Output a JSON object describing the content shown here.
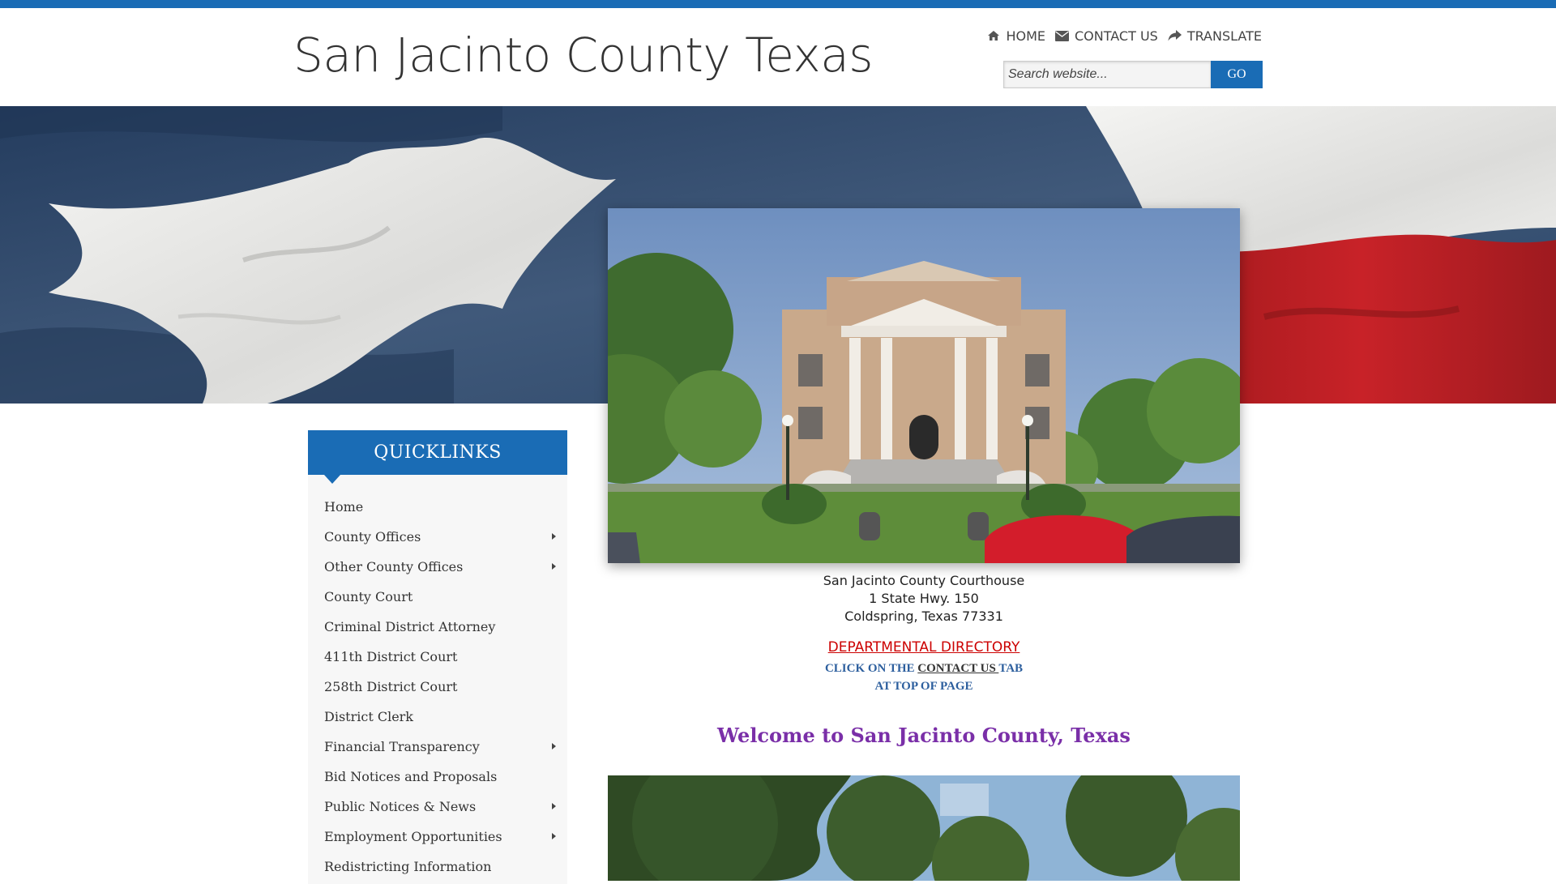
{
  "header": {
    "site_title": "San Jacinto County Texas",
    "nav": [
      {
        "label": "HOME",
        "icon": "home-icon"
      },
      {
        "label": "CONTACT US",
        "icon": "envelope-icon"
      },
      {
        "label": "TRANSLATE",
        "icon": "share-arrow-icon"
      }
    ],
    "search": {
      "placeholder": "Search website...",
      "value": "",
      "button_label": "GO"
    }
  },
  "colors": {
    "accent": "#1a6cb5",
    "link_red": "#cc0000",
    "welcome_purple": "#7a2fa8",
    "note_blue": "#2d5f9e"
  },
  "quicklinks": {
    "title": "QUICKLINKS",
    "items": [
      {
        "label": "Home",
        "has_submenu": false
      },
      {
        "label": "County Offices",
        "has_submenu": true
      },
      {
        "label": "Other County Offices",
        "has_submenu": true
      },
      {
        "label": "County Court",
        "has_submenu": false
      },
      {
        "label": "Criminal District Attorney",
        "has_submenu": false
      },
      {
        "label": "411th District Court",
        "has_submenu": false
      },
      {
        "label": "258th District Court",
        "has_submenu": false
      },
      {
        "label": "District Clerk",
        "has_submenu": false
      },
      {
        "label": "Financial Transparency",
        "has_submenu": true
      },
      {
        "label": "Bid Notices and Proposals",
        "has_submenu": false
      },
      {
        "label": "Public Notices & News",
        "has_submenu": true
      },
      {
        "label": "Employment Opportunities",
        "has_submenu": true
      },
      {
        "label": "Redistricting Information",
        "has_submenu": false
      }
    ]
  },
  "main": {
    "address": {
      "line1": "San Jacinto County Courthouse",
      "line2": "1 State Hwy. 150",
      "line3": "Coldspring, Texas 77331"
    },
    "departmental_directory": "DEPARTMENTAL DIRECTORY",
    "contact_note": {
      "prefix": "CLICK ON THE ",
      "link": "CONTACT US ",
      "suffix": "TAB",
      "line2": "AT TOP OF PAGE"
    },
    "welcome": "Welcome to San Jacinto County, Texas"
  }
}
